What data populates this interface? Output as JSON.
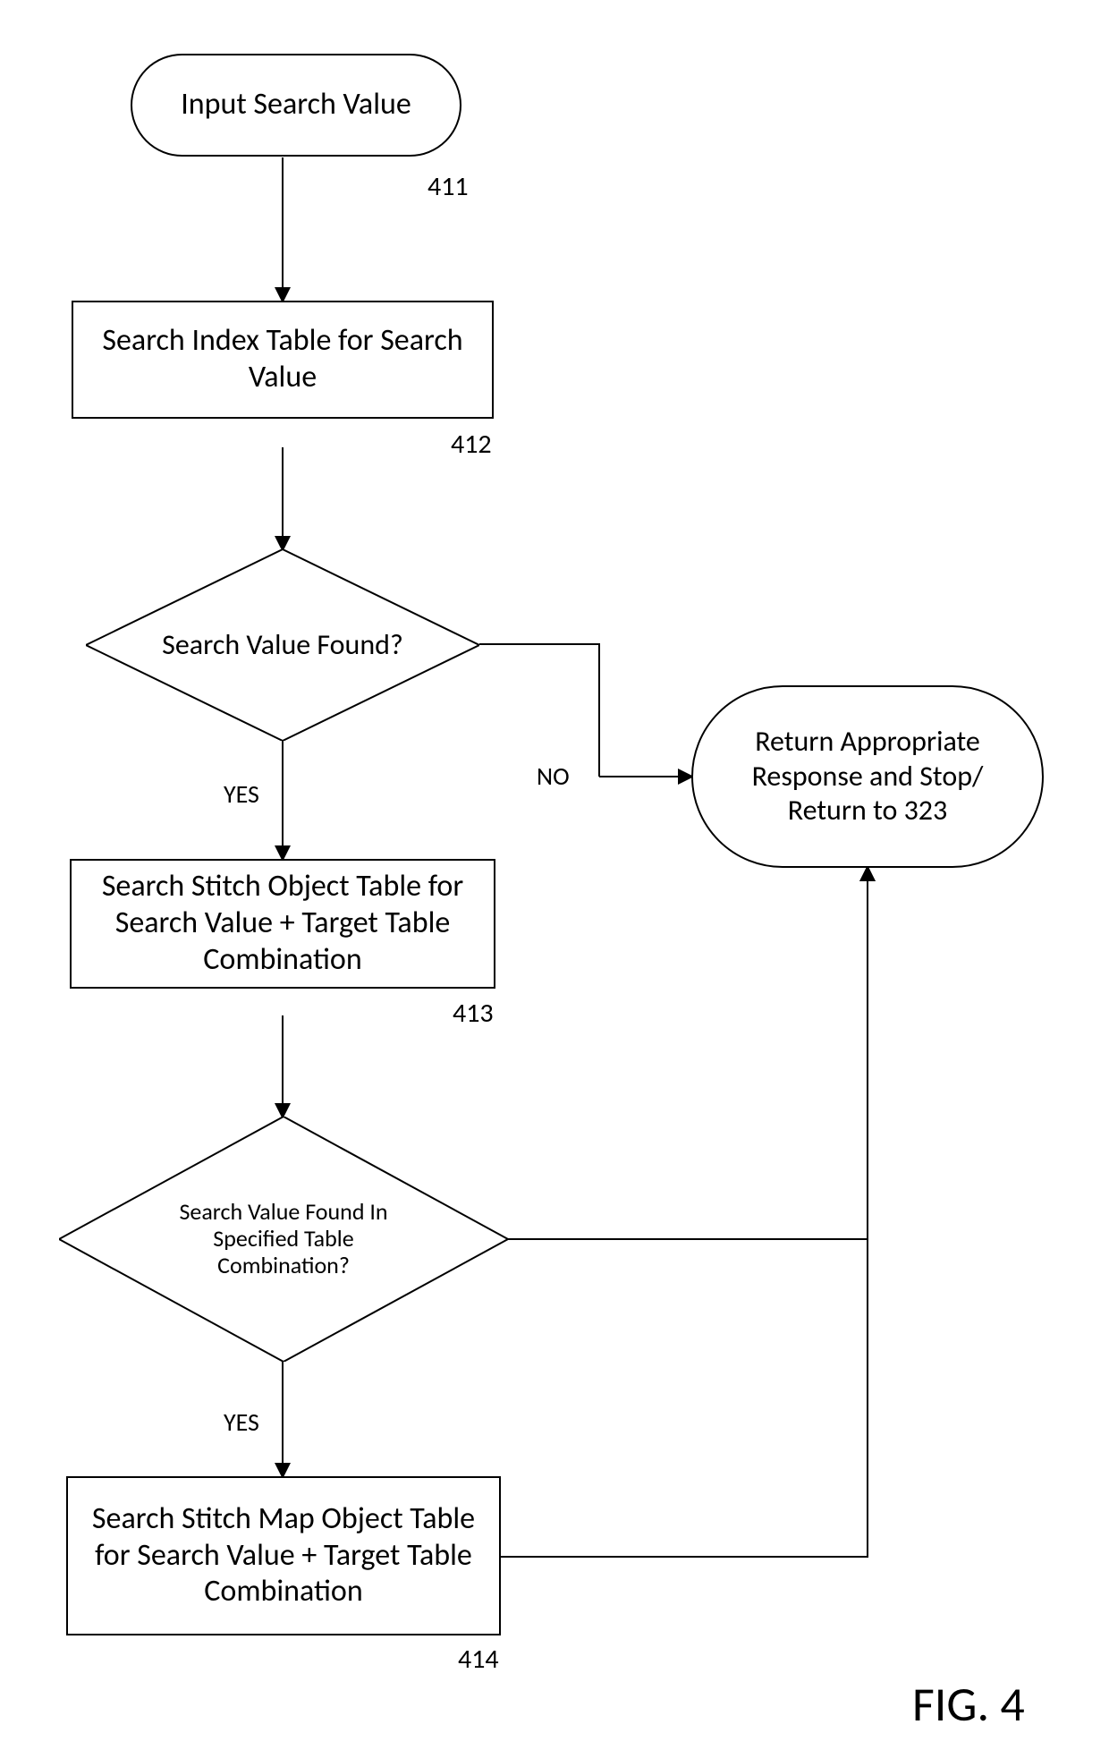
{
  "nodes": {
    "n411": {
      "text": "Input Search Value",
      "ref": "411"
    },
    "n412": {
      "text": "Search Index Table for Search Value",
      "ref": "412"
    },
    "d1": {
      "text": "Search Value Found?"
    },
    "n413": {
      "text": "Search Stitch Object Table for Search Value + Target Table Combination",
      "ref": "413"
    },
    "d2": {
      "text": "Search Value Found In Specified Table Combination?"
    },
    "n414": {
      "text": "Search Stitch Map Object Table for Search Value + Target Table Combination",
      "ref": "414"
    },
    "term": {
      "text": "Return Appropriate Response and Stop/ Return to 323"
    }
  },
  "edges": {
    "yes": "YES",
    "no": "NO"
  },
  "figure_label": "FIG. 4"
}
